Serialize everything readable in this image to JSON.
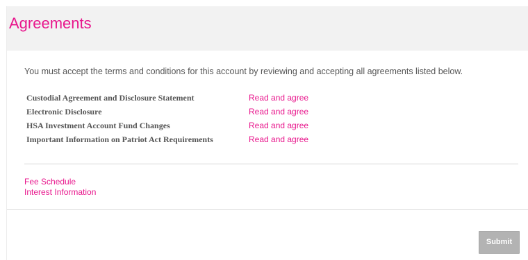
{
  "header": {
    "title": "Agreements"
  },
  "intro": {
    "text": "You must accept the terms and conditions for this account by reviewing and accepting all agreements listed below."
  },
  "agreements": [
    {
      "name": "Custodial Agreement and Disclosure Statement",
      "action": "Read and agree"
    },
    {
      "name": "Electronic Disclosure",
      "action": "Read and agree"
    },
    {
      "name": "HSA Investment Account Fund Changes",
      "action": "Read and agree"
    },
    {
      "name": "Important Information on Patriot Act Requirements",
      "action": "Read and agree"
    }
  ],
  "extra_links": [
    {
      "label": "Fee Schedule"
    },
    {
      "label": "Interest Information"
    }
  ],
  "footer": {
    "submit_label": "Submit"
  },
  "colors": {
    "accent": "#e8168c",
    "header_bg": "#f2f2f2",
    "text": "#555555",
    "button_disabled": "#b3b3b3"
  }
}
